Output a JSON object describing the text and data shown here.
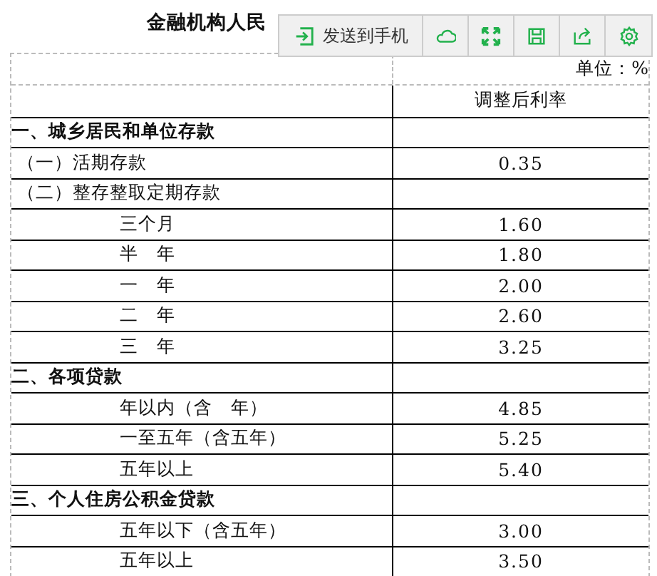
{
  "title": "金融机构人民",
  "toolbar": {
    "send_label": "发送到手机"
  },
  "table": {
    "unit": "单位：%",
    "column_header": "调整后利率",
    "rows": [
      {
        "kind": "section",
        "label": "一、城乡居民和单位存款"
      },
      {
        "kind": "item",
        "label": "（一）活期存款",
        "value": "0.35"
      },
      {
        "kind": "item",
        "label": "（二）整存整取定期存款"
      },
      {
        "kind": "sub",
        "label": "三个月",
        "value": "1.60"
      },
      {
        "kind": "sub",
        "label": "半　年",
        "value": "1.80"
      },
      {
        "kind": "sub",
        "label": "一　年",
        "value": "2.00"
      },
      {
        "kind": "sub",
        "label": "二　年",
        "value": "2.60"
      },
      {
        "kind": "sub",
        "label": "三　年",
        "value": "3.25"
      },
      {
        "kind": "section",
        "label": "二、各项贷款"
      },
      {
        "kind": "sub",
        "label": "年以内（含　年）",
        "value": "4.85"
      },
      {
        "kind": "sub",
        "label": "一至五年（含五年）",
        "value": "5.25"
      },
      {
        "kind": "sub",
        "label": "五年以上",
        "value": "5.40"
      },
      {
        "kind": "section",
        "label": "三、个人住房公积金贷款"
      },
      {
        "kind": "sub",
        "label": "五年以下（含五年）",
        "value": "3.00"
      },
      {
        "kind": "sub",
        "label": "五年以上",
        "value": "3.50"
      }
    ]
  }
}
